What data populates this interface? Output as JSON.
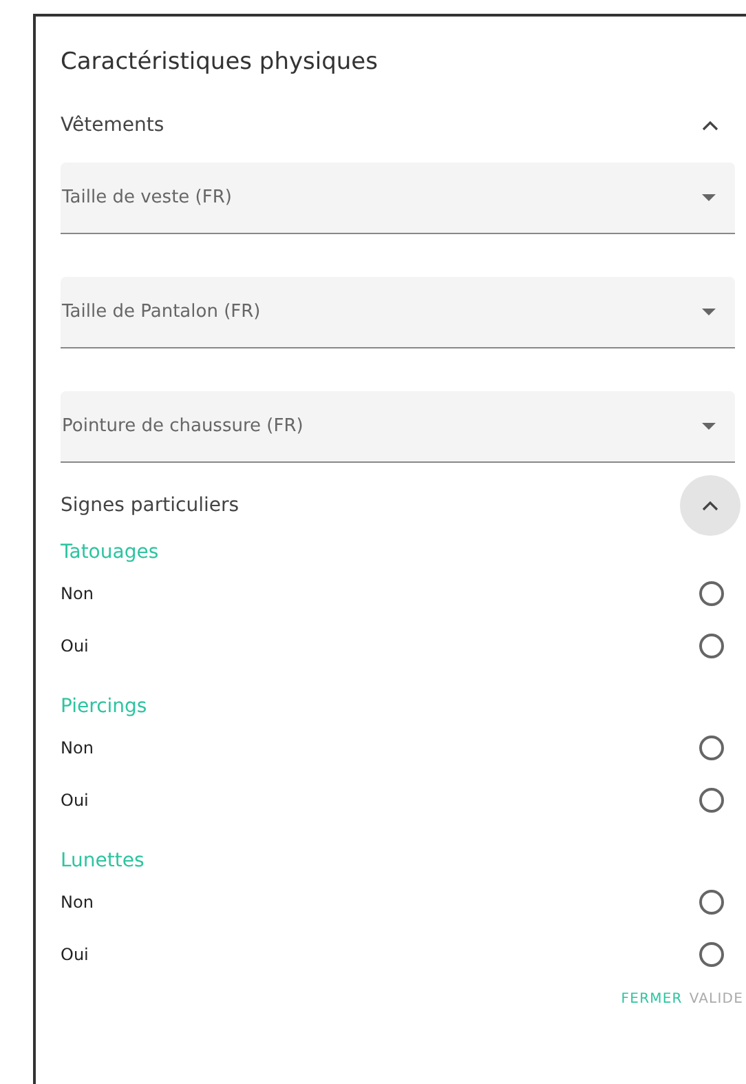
{
  "title": "Caractéristiques physiques",
  "sections": [
    {
      "label": "Vêtements",
      "expanded": true,
      "focused": false,
      "kind": "selects",
      "fields": [
        {
          "placeholder": "Taille de veste (FR)"
        },
        {
          "placeholder": "Taille de Pantalon (FR)"
        },
        {
          "placeholder": "Pointure de chaussure (FR)"
        }
      ]
    },
    {
      "label": "Signes particuliers",
      "expanded": true,
      "focused": true,
      "kind": "radios",
      "groups": [
        {
          "label": "Tatouages",
          "options": [
            {
              "label": "Non",
              "selected": false
            },
            {
              "label": "Oui",
              "selected": false
            }
          ]
        },
        {
          "label": "Piercings",
          "options": [
            {
              "label": "Non",
              "selected": false
            },
            {
              "label": "Oui",
              "selected": false
            }
          ]
        },
        {
          "label": "Lunettes",
          "options": [
            {
              "label": "Non",
              "selected": false
            },
            {
              "label": "Oui",
              "selected": false
            }
          ]
        }
      ]
    }
  ],
  "actions": [
    {
      "label": "FERMER",
      "disabled": false
    },
    {
      "label": "VALIDE",
      "disabled": true
    }
  ]
}
